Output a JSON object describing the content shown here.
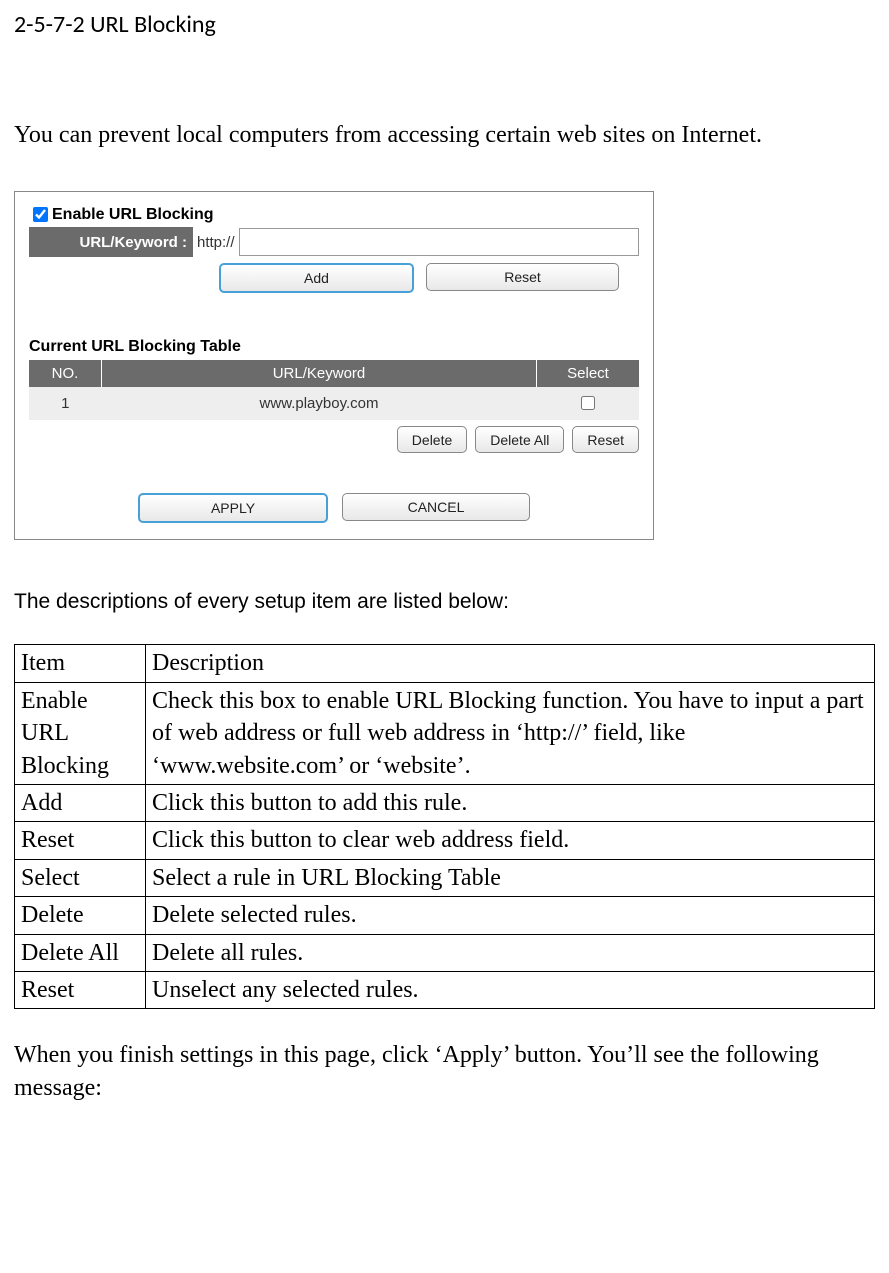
{
  "heading": "2-5-7-2 URL Blocking",
  "intro": "You can prevent local computers from accessing certain web sites on Internet.",
  "panel": {
    "enable_label": "Enable URL Blocking",
    "url_keyword_label": "URL/Keyword :",
    "url_prefix": "http://",
    "add_btn": "Add",
    "reset_btn": "Reset",
    "table_title": "Current URL Blocking Table",
    "headers": {
      "no": "NO.",
      "urlkw": "URL/Keyword",
      "select": "Select"
    },
    "rows": [
      {
        "no": "1",
        "url": "www.playboy.com"
      }
    ],
    "delete_btn": "Delete",
    "delete_all_btn": "Delete All",
    "reset2_btn": "Reset",
    "apply_btn": "APPLY",
    "cancel_btn": "CANCEL"
  },
  "desc_intro": "The descriptions of every setup item are listed below:",
  "desc_table": {
    "header": {
      "item": "Item",
      "desc": "Description"
    },
    "rows": [
      {
        "item": "Enable URL Blocking",
        "desc": "Check this box to enable URL Blocking function. You have to input a part of web address or full web address in ‘http://’ field, like ‘www.website.com’ or ‘website’."
      },
      {
        "item": "Add",
        "desc": "Click this button to add this rule."
      },
      {
        "item": "Reset",
        "desc": "Click this button to clear web address field."
      },
      {
        "item": "Select",
        "desc": "Select a rule in URL Blocking Table"
      },
      {
        "item": "Delete",
        "desc": "Delete selected rules."
      },
      {
        "item": "Delete All",
        "desc": "Delete all rules."
      },
      {
        "item": "Reset",
        "desc": "Unselect any selected rules."
      }
    ]
  },
  "closing": "When you finish settings in this page, click ‘Apply’ button. You’ll see the following message:"
}
